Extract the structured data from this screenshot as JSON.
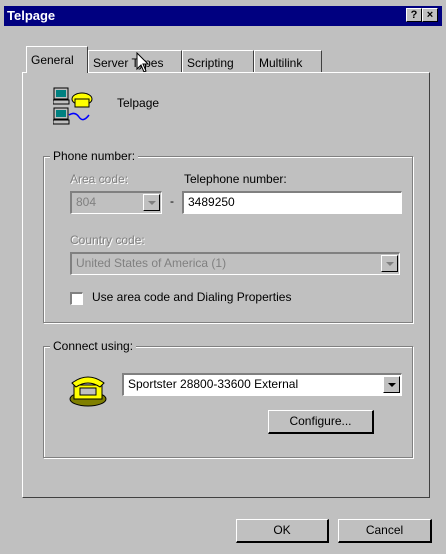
{
  "window": {
    "title": "Telpage",
    "help_label": "?",
    "close_label": "×"
  },
  "tabs": [
    {
      "label": "General",
      "active": true
    },
    {
      "label": "Server Types",
      "active": false
    },
    {
      "label": "Scripting",
      "active": false
    },
    {
      "label": "Multilink",
      "active": false
    }
  ],
  "connection_name": "Telpage",
  "phone": {
    "group_label": "Phone number:",
    "area_code_label": "Area code:",
    "area_code_value": "804",
    "separator": "-",
    "telephone_label": "Telephone number:",
    "telephone_value": "3489250",
    "country_code_label": "Country code:",
    "country_value": "United States of America (1)",
    "use_area_code_label": "Use area code and Dialing Properties",
    "use_area_code_checked": false
  },
  "connect": {
    "group_label": "Connect using:",
    "device_value": "Sportster 28800-33600 External",
    "configure_label": "Configure..."
  },
  "footer": {
    "ok_label": "OK",
    "cancel_label": "Cancel"
  },
  "icons": [
    "network-computers-icon",
    "phone-modem-icon",
    "mouse-cursor-icon"
  ]
}
